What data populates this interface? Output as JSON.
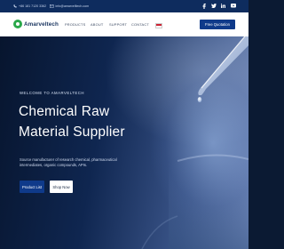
{
  "topbar": {
    "phone": "+86 181 7120 3362",
    "email": "info@amarvelltech.com",
    "social_icons": [
      "facebook-icon",
      "twitter-icon",
      "linkedin-icon",
      "youtube-icon"
    ]
  },
  "nav": {
    "logo_text": "Amarveltech",
    "menu": [
      "PRODUCTS",
      "ABOUT",
      "SUPPORT",
      "CONTACT"
    ],
    "quote_label": "Free Quotation"
  },
  "hero": {
    "welcome": "WELCOME TO AMARVELTECH",
    "title_line1": "Chemical Raw",
    "title_line2": "Material Supplier",
    "subtitle": "Source manufacturer of research chemical, pharmaceutical intermediates, organic compounds, APIs.",
    "primary_button": "Product List",
    "secondary_button": "Shop Now"
  },
  "colors": {
    "topbar": "#0e2c5e",
    "brand_blue": "#0f3a8a",
    "logo_green": "#2aa84a"
  }
}
